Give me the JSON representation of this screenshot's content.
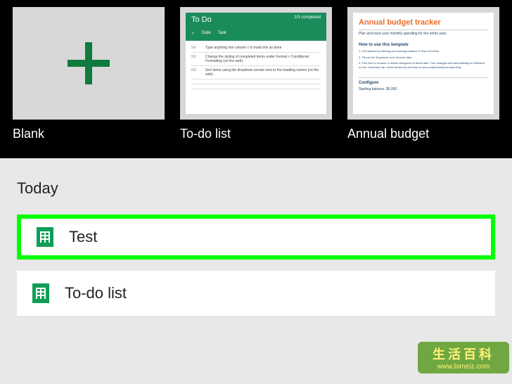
{
  "templates": {
    "blank": {
      "label": "Blank"
    },
    "todo": {
      "label": "To-do list",
      "header_title": "To Do",
      "completed_text": "1/3 completed",
      "col_date": "Date",
      "col_task": "Task",
      "rows": [
        {
          "date": "5/6",
          "task": "Type anything into column c to mark this as done"
        },
        {
          "date": "5/9",
          "task": "Change the styling of completed items under Format > Conditional Formatting (on the web)"
        },
        {
          "date": "6/9",
          "task": "Sort items using the dropdown arrows next to the heading names (on the web)"
        }
      ]
    },
    "budget": {
      "label": "Annual budget",
      "title": "Annual budget tracker",
      "subtitle": "Plan and track your monthly spending for the entire year.",
      "howto_title": "How to use this template",
      "steps": [
        "1. Get started by entering your starting balance in Row 13 below.",
        "2. Fill out the 'Expenses' and 'Income' tabs.",
        "3. Feel free to rename or delete categories in these tabs. Your changes will automatically be reflected on the 'Summary' tab, which shows an overview of your projected/actual spending."
      ],
      "configure_label": "Configure",
      "balance_label": "Starting balance:",
      "balance_value": "$5,000"
    }
  },
  "recent": {
    "heading": "Today",
    "files": [
      {
        "name": "Test",
        "highlighted": true
      },
      {
        "name": "To-do list",
        "highlighted": false
      }
    ]
  },
  "watermark": {
    "cn": "生活百科",
    "url": "www.bimeiz.com"
  }
}
